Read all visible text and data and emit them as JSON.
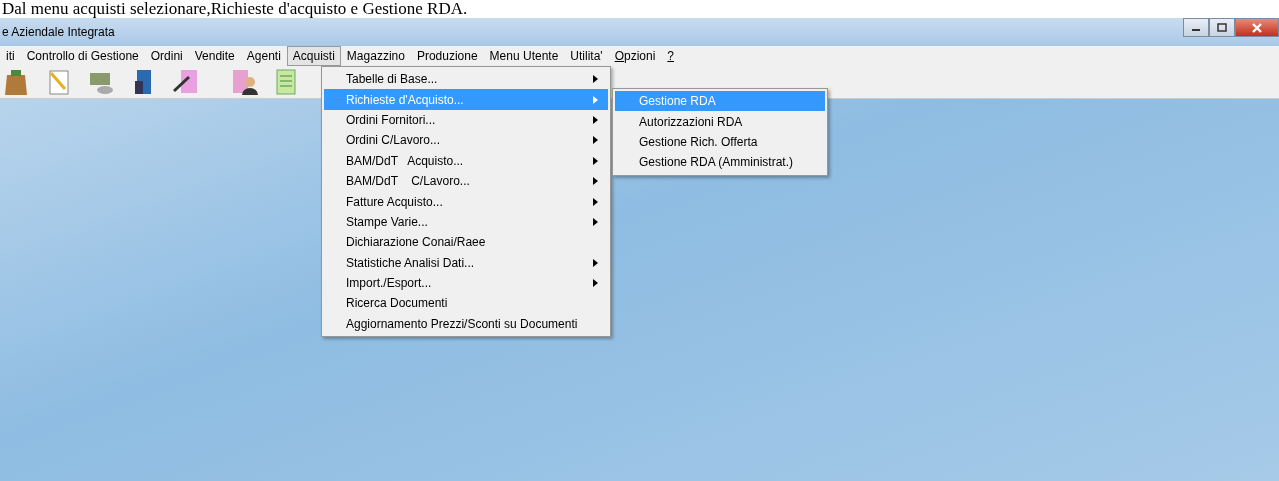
{
  "caption": "Dal menu acquisti selezionare,Richieste d'acquisto e Gestione RDA.",
  "window": {
    "title": "e Aziendale Integrata"
  },
  "menubar": [
    {
      "label": "iti",
      "selected": false,
      "accelerator": false
    },
    {
      "label": "Controllo di Gestione",
      "selected": false,
      "accelerator": false
    },
    {
      "label": "Ordini",
      "selected": false,
      "accelerator": false
    },
    {
      "label": "Vendite",
      "selected": false,
      "accelerator": false
    },
    {
      "label": "Agenti",
      "selected": false,
      "accelerator": false
    },
    {
      "label": "Acquisti",
      "selected": true,
      "accelerator": false
    },
    {
      "label": "Magazzino",
      "selected": false,
      "accelerator": false
    },
    {
      "label": "Produzione",
      "selected": false,
      "accelerator": false
    },
    {
      "label": "Menu Utente",
      "selected": false,
      "accelerator": false
    },
    {
      "label": "Utilita'",
      "selected": false,
      "accelerator": false
    },
    {
      "label": "Opzioni",
      "selected": false,
      "accelerator": true
    },
    {
      "label": "?",
      "selected": false,
      "accelerator": true
    }
  ],
  "menu": [
    {
      "label": "Tabelle di Base...",
      "submenu": true,
      "selected": false
    },
    {
      "label": "Richieste d'Acquisto...",
      "submenu": true,
      "selected": true
    },
    {
      "label": "Ordini Fornitori...",
      "submenu": true,
      "selected": false
    },
    {
      "label": "Ordini C/Lavoro...",
      "submenu": true,
      "selected": false
    },
    {
      "label": "BAM/DdT   Acquisto...",
      "submenu": true,
      "selected": false
    },
    {
      "label": "BAM/DdT    C/Lavoro...",
      "submenu": true,
      "selected": false
    },
    {
      "label": "Fatture Acquisto...",
      "submenu": true,
      "selected": false
    },
    {
      "label": "Stampe Varie...",
      "submenu": true,
      "selected": false
    },
    {
      "label": "Dichiarazione Conai/Raee",
      "submenu": false,
      "selected": false
    },
    {
      "label": "Statistiche Analisi Dati...",
      "submenu": true,
      "selected": false
    },
    {
      "label": "Import./Esport...",
      "submenu": true,
      "selected": false
    },
    {
      "label": "Ricerca Documenti",
      "submenu": false,
      "selected": false
    },
    {
      "label": "Aggiornamento Prezzi/Sconti su Documenti",
      "submenu": false,
      "selected": false
    }
  ],
  "submenu": [
    {
      "label": "Gestione RDA",
      "selected": true
    },
    {
      "label": "Autorizzazioni RDA",
      "selected": false
    },
    {
      "label": "Gestione Rich. Offerta",
      "selected": false
    },
    {
      "label": "Gestione RDA (Amministrat.)",
      "selected": false
    }
  ]
}
